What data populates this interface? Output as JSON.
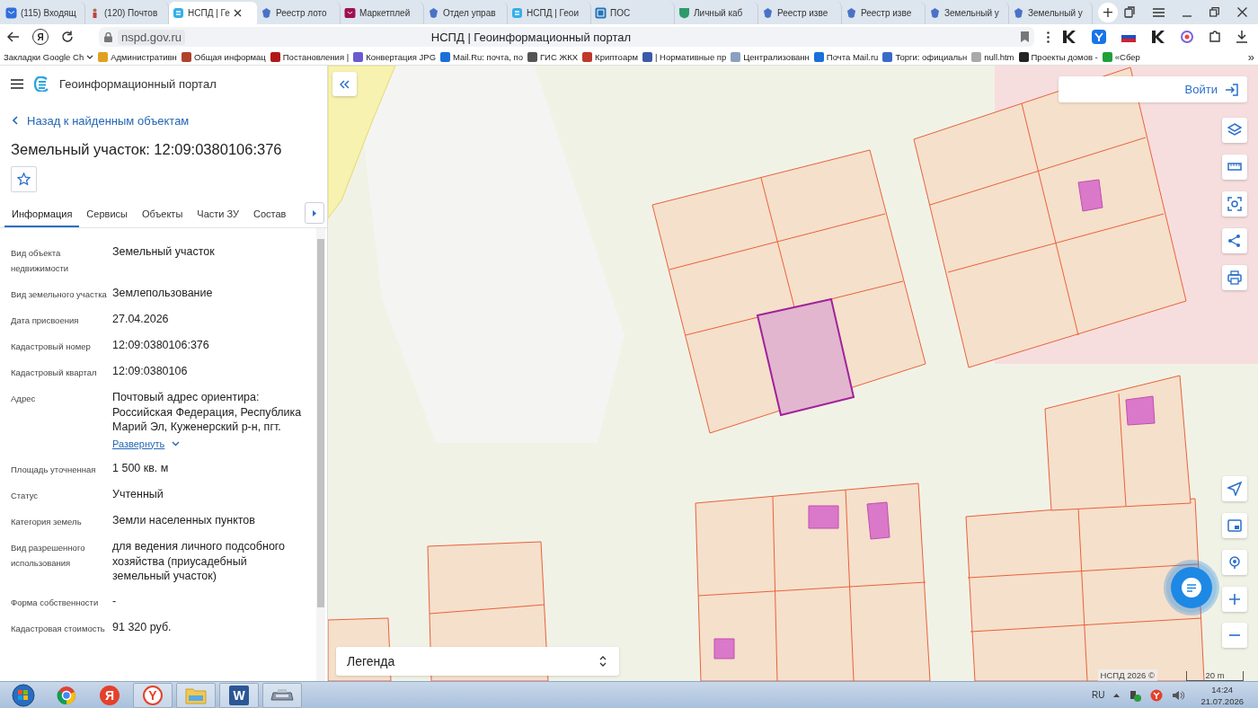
{
  "browser": {
    "tabs": [
      {
        "title": "(115) Входящ",
        "kind": "mail",
        "selected": false
      },
      {
        "title": "(120) Почтов",
        "kind": "person",
        "selected": false
      },
      {
        "title": "НСПД | Ге",
        "kind": "nspd",
        "selected": true
      },
      {
        "title": "Реестр лото",
        "kind": "emblem",
        "selected": false
      },
      {
        "title": "Маркетплей",
        "kind": "market",
        "selected": false
      },
      {
        "title": "Отдел управ",
        "kind": "emblem",
        "selected": false
      },
      {
        "title": "НСПД | Геои",
        "kind": "nspd",
        "selected": false
      },
      {
        "title": "ПОС",
        "kind": "pos",
        "selected": false
      },
      {
        "title": "Личный каб",
        "kind": "shield",
        "selected": false
      },
      {
        "title": "Реестр изве",
        "kind": "emblem",
        "selected": false
      },
      {
        "title": "Реестр изве",
        "kind": "emblem",
        "selected": false
      },
      {
        "title": "Земельный у",
        "kind": "emblem",
        "selected": false
      },
      {
        "title": "Земельный у",
        "kind": "emblem",
        "selected": false
      }
    ],
    "new_tab": "+",
    "home_glyph": "Я",
    "url": "nspd.gov.ru",
    "page_title": "НСПД | Геоинформационный портал",
    "bookmarks_folder": "Закладки Google Ch",
    "bookmarks": [
      {
        "label": "Административн",
        "color": "#e0a020"
      },
      {
        "label": "Общая информац",
        "color": "#b0402a"
      },
      {
        "label": "Постановления |",
        "color": "#b01818"
      },
      {
        "label": "Конвертация JPG",
        "color": "#6a5ad0"
      },
      {
        "label": "Mail.Ru: почта, по",
        "color": "#1a6fd8"
      },
      {
        "label": "ГИС ЖКХ",
        "color": "#555555"
      },
      {
        "label": "Криптоарм",
        "color": "#c0392b"
      },
      {
        "label": "| Нормативные пр",
        "color": "#3d5aa8"
      },
      {
        "label": "Централизованн",
        "color": "#8aa0c0"
      },
      {
        "label": "Почта Mail.ru",
        "color": "#1a6fd8"
      },
      {
        "label": "Торги: официальн",
        "color": "#3a6ac8"
      },
      {
        "label": "null.htm",
        "color": "#aaaaaa"
      },
      {
        "label": "Проекты домов -",
        "color": "#222222"
      },
      {
        "label": "«Сбер",
        "color": "#21a038"
      }
    ],
    "bookmarks_more": "»"
  },
  "portal": {
    "title": "Геоинформационный портал",
    "back_link": "Назад к найденным объектам",
    "object_title": "Земельный участок: 12:09:0380106:376",
    "tabs": [
      {
        "label": "Информация",
        "selected": true
      },
      {
        "label": "Сервисы",
        "selected": false
      },
      {
        "label": "Объекты",
        "selected": false
      },
      {
        "label": "Части ЗУ",
        "selected": false
      },
      {
        "label": "Состав",
        "selected": false
      }
    ],
    "properties": [
      {
        "label": "Вид объекта недвижимости",
        "value": "Земельный участок"
      },
      {
        "label": "Вид земельного участка",
        "value": "Землепользование"
      },
      {
        "label": "Дата присвоения",
        "value": "27.04.2026"
      },
      {
        "label": "Кадастровый номер",
        "value": "12:09:0380106:376"
      },
      {
        "label": "Кадастровый квартал",
        "value": "12:09:0380106"
      },
      {
        "label": "Адрес",
        "value": "Почтовый адрес ориентира: Российская Федерация, Республика Марий Эл, Куженерский р-н, пгт.",
        "link": "Развернуть"
      },
      {
        "label": "Площадь уточненная",
        "value": "1 500 кв. м"
      },
      {
        "label": "Статус",
        "value": "Учтенный"
      },
      {
        "label": "Категория земель",
        "value": "Земли населенных пунктов"
      },
      {
        "label": "Вид разрешенного использования",
        "value": "для ведения личного подсобного хозяйства (приусадебный земельный участок)"
      },
      {
        "label": "Форма собственности",
        "value": "-"
      },
      {
        "label": "Кадастровая стоимость",
        "value": "91 320 руб."
      }
    ]
  },
  "map": {
    "kind": "picture",
    "login": "Войти",
    "legend": "Легенда",
    "attribution": "НСПД 2026 ©",
    "scale": "20 m"
  },
  "taskbar": {
    "apps": [
      {
        "kind": "start"
      },
      {
        "kind": "chrome"
      },
      {
        "kind": "letter",
        "glyph": "Я"
      },
      {
        "kind": "ybrowser",
        "glyph": "Y"
      },
      {
        "kind": "folder"
      },
      {
        "kind": "word",
        "glyph": "W"
      },
      {
        "kind": "device"
      }
    ],
    "language": "RU",
    "time": "14:24",
    "date": "21.07.2026"
  }
}
